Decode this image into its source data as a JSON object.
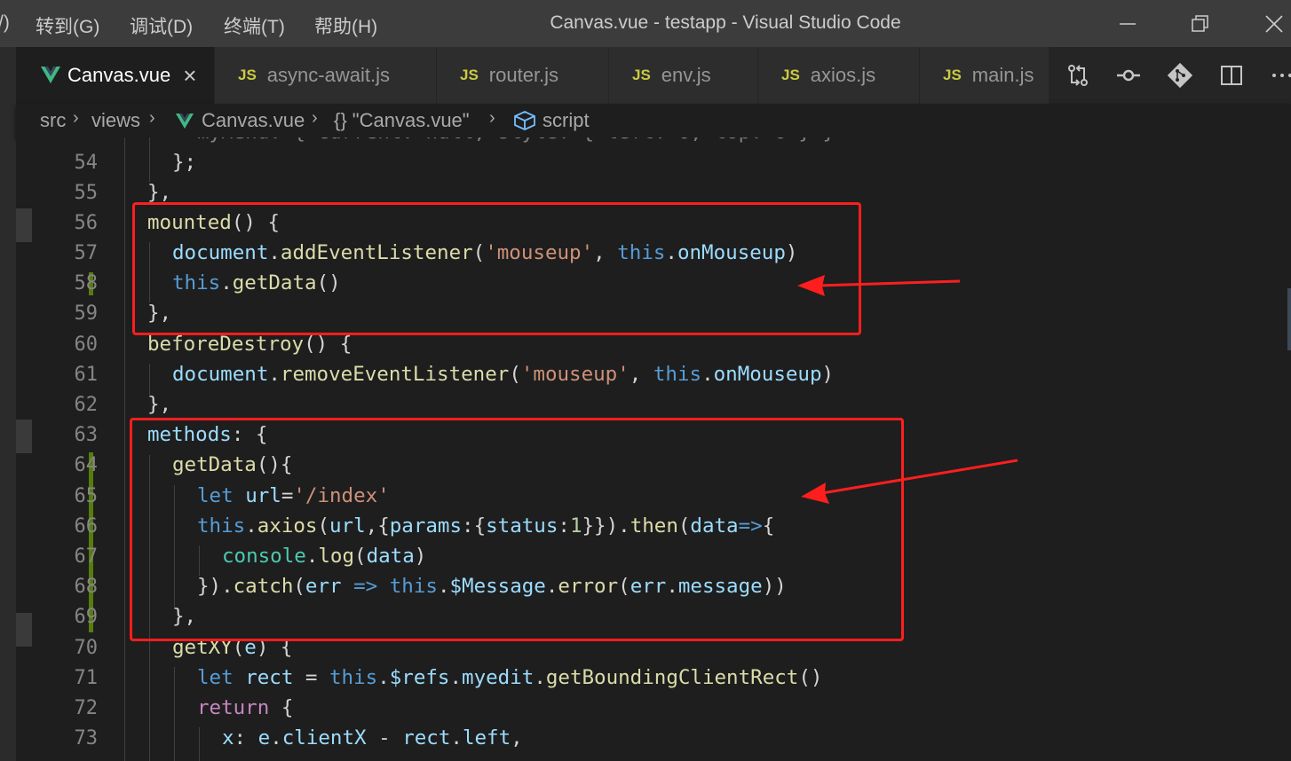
{
  "titlebar": {
    "menu": [
      {
        "label": "/)"
      },
      {
        "label": "转到(G)"
      },
      {
        "label": "调试(D)"
      },
      {
        "label": "终端(T)"
      },
      {
        "label": "帮助(H)"
      }
    ],
    "window_title": "Canvas.vue - testapp - Visual Studio Code"
  },
  "tabs": [
    {
      "label": "Canvas.vue",
      "icon": "vue-icon",
      "active": true
    },
    {
      "label": "async-await.js",
      "badge": "JS"
    },
    {
      "label": "router.js",
      "badge": "JS"
    },
    {
      "label": "env.js",
      "badge": "JS"
    },
    {
      "label": "axios.js",
      "badge": "JS"
    },
    {
      "label": "main.js",
      "badge": "JS"
    }
  ],
  "toolbar_icons": [
    "compare-changes-icon",
    "open-changes-icon",
    "git-icon",
    "split-editor-icon",
    "more-actions-icon"
  ],
  "breadcrumb": {
    "items": [
      "src",
      "views",
      "Canvas.vue",
      "{} \"Canvas.vue\"",
      "script"
    ]
  },
  "editor": {
    "language": "vue",
    "line_numbers": [
      "54",
      "55",
      "56",
      "57",
      "58",
      "59",
      "60",
      "61",
      "62",
      "63",
      "64",
      "65",
      "66",
      "67",
      "68",
      "69",
      "70",
      "71",
      "72",
      "73"
    ],
    "tokens": {
      "l54": [
        "};"
      ],
      "l55": [
        "},"
      ],
      "l56": [
        "mounted",
        "() {"
      ],
      "l57": [
        "document",
        ".",
        "addEventListener",
        "(",
        "'mouseup'",
        ", ",
        "this",
        ".",
        "onMouseup",
        ")"
      ],
      "l58": [
        "this",
        ".",
        "getData",
        "()"
      ],
      "l59": [
        "},"
      ],
      "l60": [
        "beforeDestroy",
        "() {"
      ],
      "l61": [
        "document",
        ".",
        "removeEventListener",
        "(",
        "'mouseup'",
        ", ",
        "this",
        ".",
        "onMouseup",
        ")"
      ],
      "l62": [
        "},"
      ],
      "l63": [
        "methods",
        ": {"
      ],
      "l64": [
        "getData",
        "(){"
      ],
      "l65": [
        "let",
        " ",
        "url",
        "=",
        "'/index'"
      ],
      "l66": [
        "this",
        ".",
        "axios",
        "(",
        "url",
        ",{",
        "params",
        ":{",
        "status",
        ":",
        "1",
        "}}).",
        "then",
        "(",
        "data",
        "=>",
        "{"
      ],
      "l67": [
        "console",
        ".",
        "log",
        "(",
        "data",
        ")"
      ],
      "l68": [
        "}).",
        "catch",
        "(",
        "err",
        " ",
        "=>",
        " ",
        "this",
        ".",
        "$Message",
        ".",
        "error",
        "(",
        "err",
        ".",
        "message",
        "))"
      ],
      "l69": [
        "},"
      ],
      "l70": [
        "getXY",
        "(",
        "e",
        ") {"
      ],
      "l71": [
        "let",
        " ",
        "rect",
        " = ",
        "this",
        ".",
        "$refs",
        ".",
        "myedit",
        ".",
        "getBoundingClientRect",
        "()"
      ],
      "l72": [
        "return",
        " {"
      ],
      "l73": [
        "x",
        ": ",
        "e",
        ".",
        "clientX",
        " - ",
        "rect",
        ".",
        "left",
        ","
      ]
    }
  },
  "colors": {
    "annotation": "#ff1e1e",
    "keyword": "#569cd6",
    "function": "#dcdcaa",
    "string": "#ce9178",
    "variable": "#9cdcfe",
    "number": "#b5cea8",
    "class": "#4ec9b0",
    "control": "#c586c0",
    "git_modified": "#587c0c"
  }
}
